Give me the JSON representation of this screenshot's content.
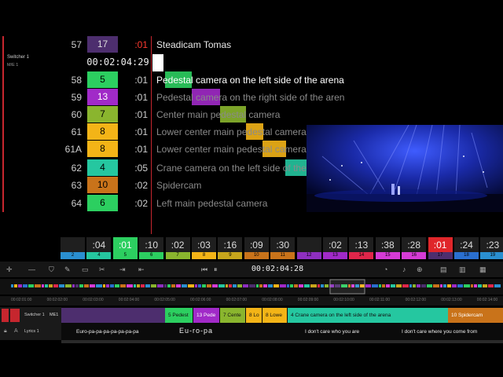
{
  "switcher": {
    "name": "Switcher 1",
    "me": "M/E 1"
  },
  "current_timecode": "00:02:04:29",
  "shots": [
    {
      "num": "57",
      "cam": "17",
      "cam_color": "#4d2e6e",
      "cam_text": "#ddd",
      "dur": ":01",
      "dur_color": "#ff3b30",
      "desc": "Steadicam Tomas",
      "desc_color": "#e8e8e8"
    },
    {
      "num": "58",
      "cam": "5",
      "cam_color": "#2ccf60",
      "dur": ":01",
      "desc": "Pedestal camera on the left side of the arena",
      "desc_color": "#ffffff"
    },
    {
      "num": "59",
      "cam": "13",
      "cam_color": "#a12ac8",
      "cam_text": "#fff",
      "dur": ":01",
      "desc": "Pedestal camera on the right side of the arena"
    },
    {
      "num": "60",
      "cam": "7",
      "cam_color": "#8ab52e",
      "dur": ":01",
      "desc": "Center main pedestal camera"
    },
    {
      "num": "61",
      "cam": "8",
      "cam_color": "#f3b417",
      "dur": ":01",
      "desc": "Lower center main pedestal camera"
    },
    {
      "num": "61A",
      "cam": "8",
      "cam_color": "#f3b417",
      "dur": ":01",
      "desc": "Lower center main pedestal camera"
    },
    {
      "num": "62",
      "cam": "4",
      "cam_color": "#25c7a0",
      "dur": ":05",
      "desc": "Crane camera on the left side of the arena"
    },
    {
      "num": "63",
      "cam": "10",
      "cam_color": "#c9731a",
      "dur": ":02",
      "desc": "Spidercam"
    },
    {
      "num": "64",
      "cam": "6",
      "cam_color": "#2ccf60",
      "dur": ":02",
      "desc": "Left main pedestal camera"
    }
  ],
  "camera_strip": [
    {
      "time": "",
      "num": "2",
      "color": "#2a8fd0"
    },
    {
      "time": ":04",
      "num": "4",
      "color": "#25c7a0"
    },
    {
      "time": ":01",
      "num": "5",
      "color": "#2ccf60",
      "active": true
    },
    {
      "time": ":10",
      "num": "6",
      "color": "#2ccf60"
    },
    {
      "time": ":02",
      "num": "7",
      "color": "#8ab52e"
    },
    {
      "time": ":03",
      "num": "8",
      "color": "#f3b417"
    },
    {
      "time": ":16",
      "num": "9",
      "color": "#c7a61c"
    },
    {
      "time": ":09",
      "num": "10",
      "color": "#c9731a"
    },
    {
      "time": ":30",
      "num": "11",
      "color": "#c9731a"
    },
    {
      "time": "",
      "num": "12",
      "color": "#8e2fc0"
    },
    {
      "time": ":02",
      "num": "13",
      "color": "#a12ac8"
    },
    {
      "time": ":13",
      "num": "14",
      "color": "#e0264a"
    },
    {
      "time": ":38",
      "num": "15",
      "color": "#d63bd6"
    },
    {
      "time": ":28",
      "num": "16",
      "color": "#d63bd6"
    },
    {
      "time": ":01",
      "num": "17",
      "color": "#4d2e6e",
      "red": true
    },
    {
      "time": ":24",
      "num": "18",
      "color": "#2a6fd0"
    },
    {
      "time": ":23",
      "num": "19",
      "color": "#2a8fd0"
    }
  ],
  "transport": {
    "timecode": "00:02:04:28"
  },
  "ruler": [
    "00:02:01:00",
    "00:02:02:00",
    "00:02:03:00",
    "00:02:04:00",
    "00:02:05:00",
    "00:02:06:00",
    "00:02:07:00",
    "00:02:08:00",
    "00:02:09:00",
    "00:02:10:00",
    "00:02:11:00",
    "00:02:12:00",
    "00:02:13:00",
    "00:02:14:00"
  ],
  "tracks": {
    "switcher": {
      "name": "Switcher 1",
      "tag": "ME1"
    },
    "lyrics": {
      "name": "Lyrics 1"
    }
  },
  "clips": [
    {
      "label": "",
      "color": "#4d2e6e"
    },
    {
      "label": "5 Pedest",
      "color": "#2ccf60"
    },
    {
      "label": "13 Pede",
      "color": "#a12ac8"
    },
    {
      "label": "7 Cente",
      "color": "#8ab52e"
    },
    {
      "label": "8 Lo",
      "color": "#f3b417"
    },
    {
      "label": "8 Lowe",
      "color": "#f3b417"
    },
    {
      "label": "4 Crane camera on the left side of the arena",
      "color": "#25c7a0"
    },
    {
      "label": "10 Spidercam",
      "color": "#c9731a"
    }
  ],
  "lyrics": [
    "Euro-pa-pa-pa-pa-pa-pa-pa",
    "Eu-ro-pa",
    "I don't care who you are",
    "I don't care where you come from"
  ]
}
